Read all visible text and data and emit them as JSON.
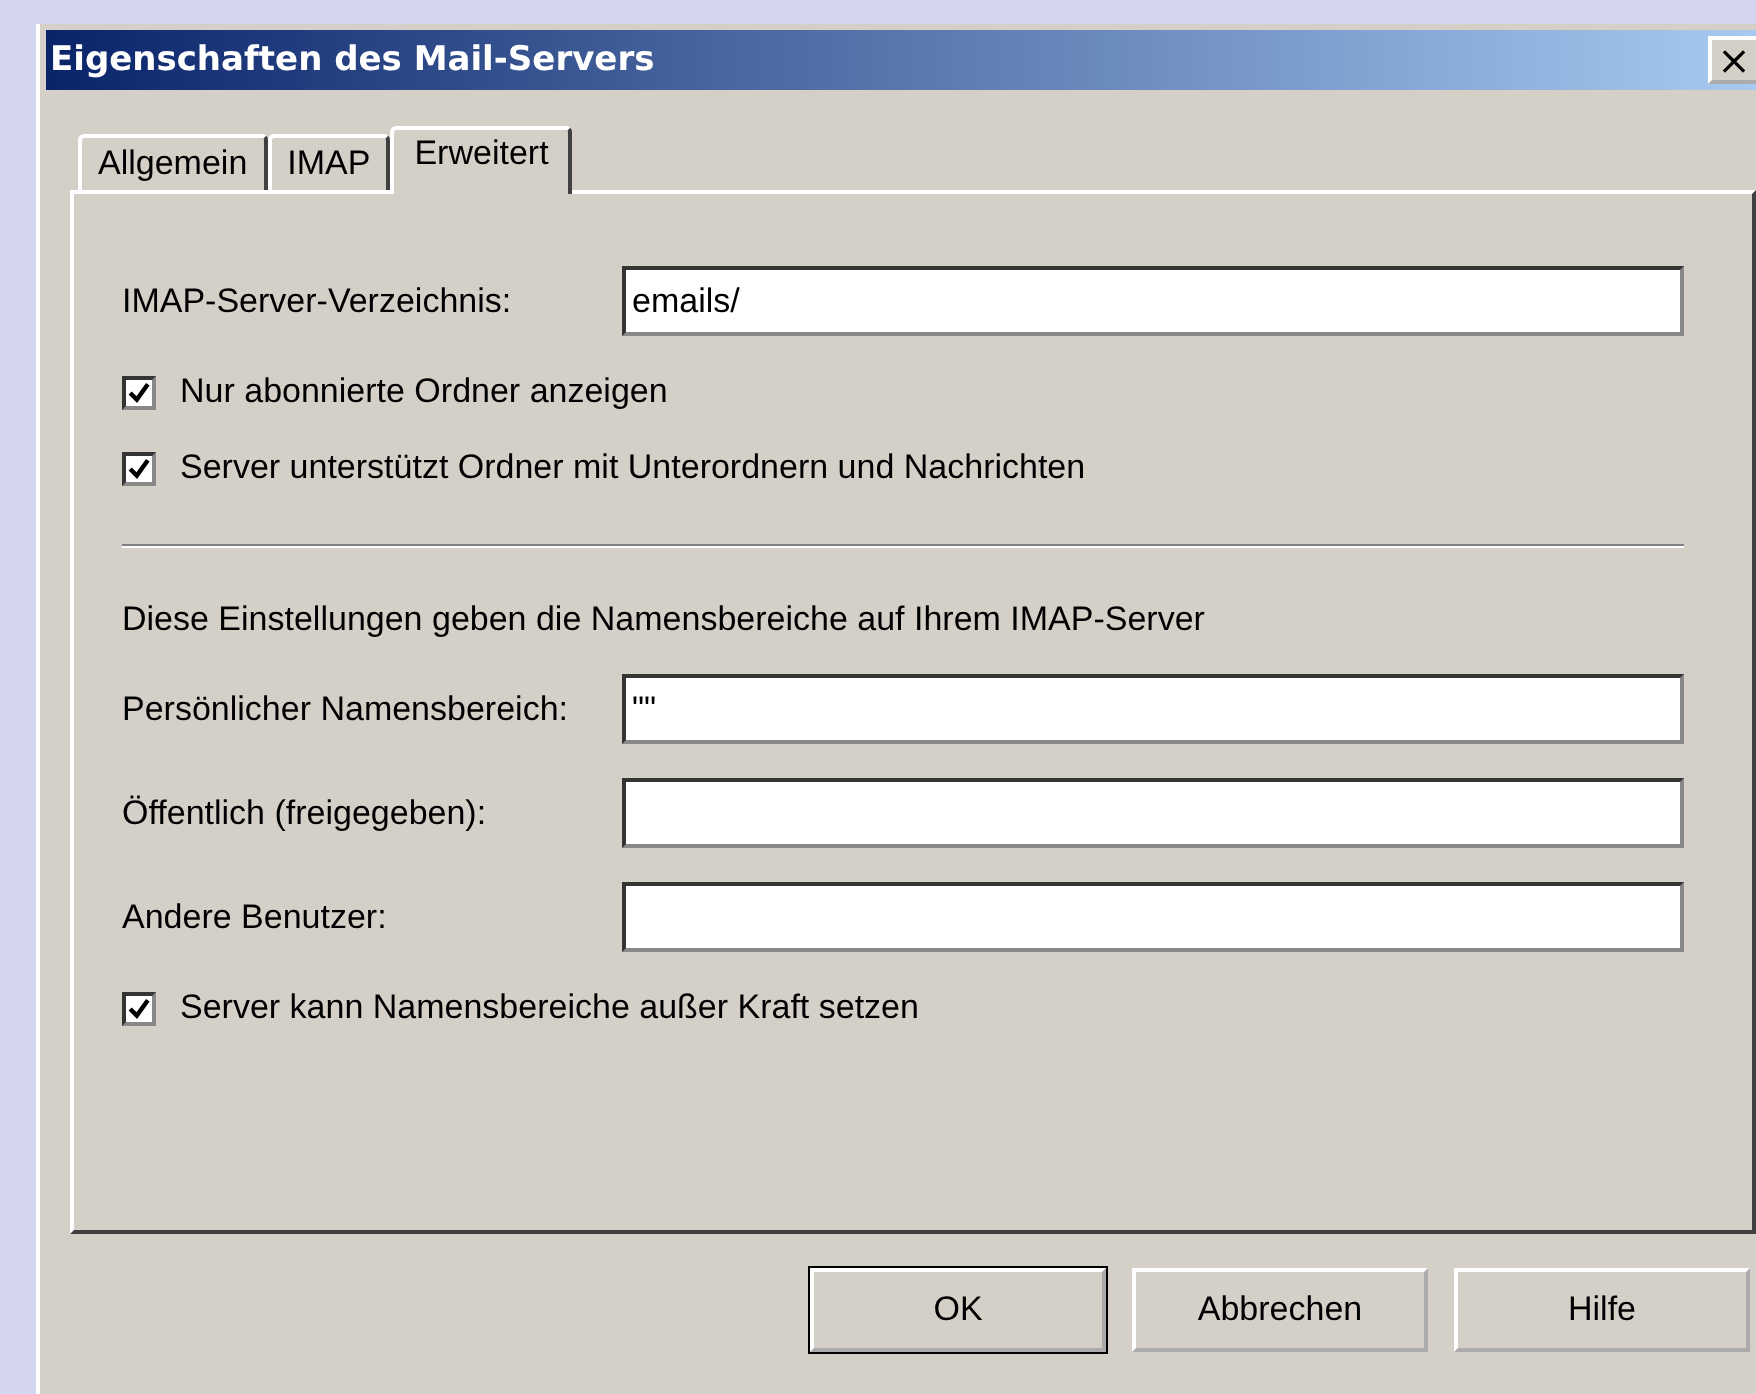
{
  "window": {
    "title": "Eigenschaften des Mail-Servers",
    "close": "×"
  },
  "tabs": [
    {
      "label": "Allgemein",
      "selected": false
    },
    {
      "label": "IMAP",
      "selected": false
    },
    {
      "label": "Erweitert",
      "selected": true
    }
  ],
  "directory": {
    "label": "IMAP-Server-Verzeichnis:",
    "value": "emails/"
  },
  "options": [
    {
      "label": "Nur abonnierte Ordner anzeigen",
      "checked": true
    },
    {
      "label": "Server unterstützt Ordner mit Unterordnern und Nachrichten",
      "checked": true
    }
  ],
  "namespaces": {
    "description": "Diese Einstellungen geben die Namensbereiche auf Ihrem IMAP-Server",
    "fields": [
      {
        "label": "Persönlicher Namensbereich:",
        "value": "\"\""
      },
      {
        "label": "Öffentlich (freigegeben):"
      },
      {
        "label": "Andere Benutzer:"
      }
    ],
    "override": {
      "label": "Server kann Namensbereiche außer Kraft setzen",
      "checked": true
    }
  },
  "buttons": [
    {
      "label": "OK",
      "default": true
    },
    {
      "label": "Abbrechen",
      "default": false
    },
    {
      "label": "Hilfe",
      "default": false
    }
  ]
}
